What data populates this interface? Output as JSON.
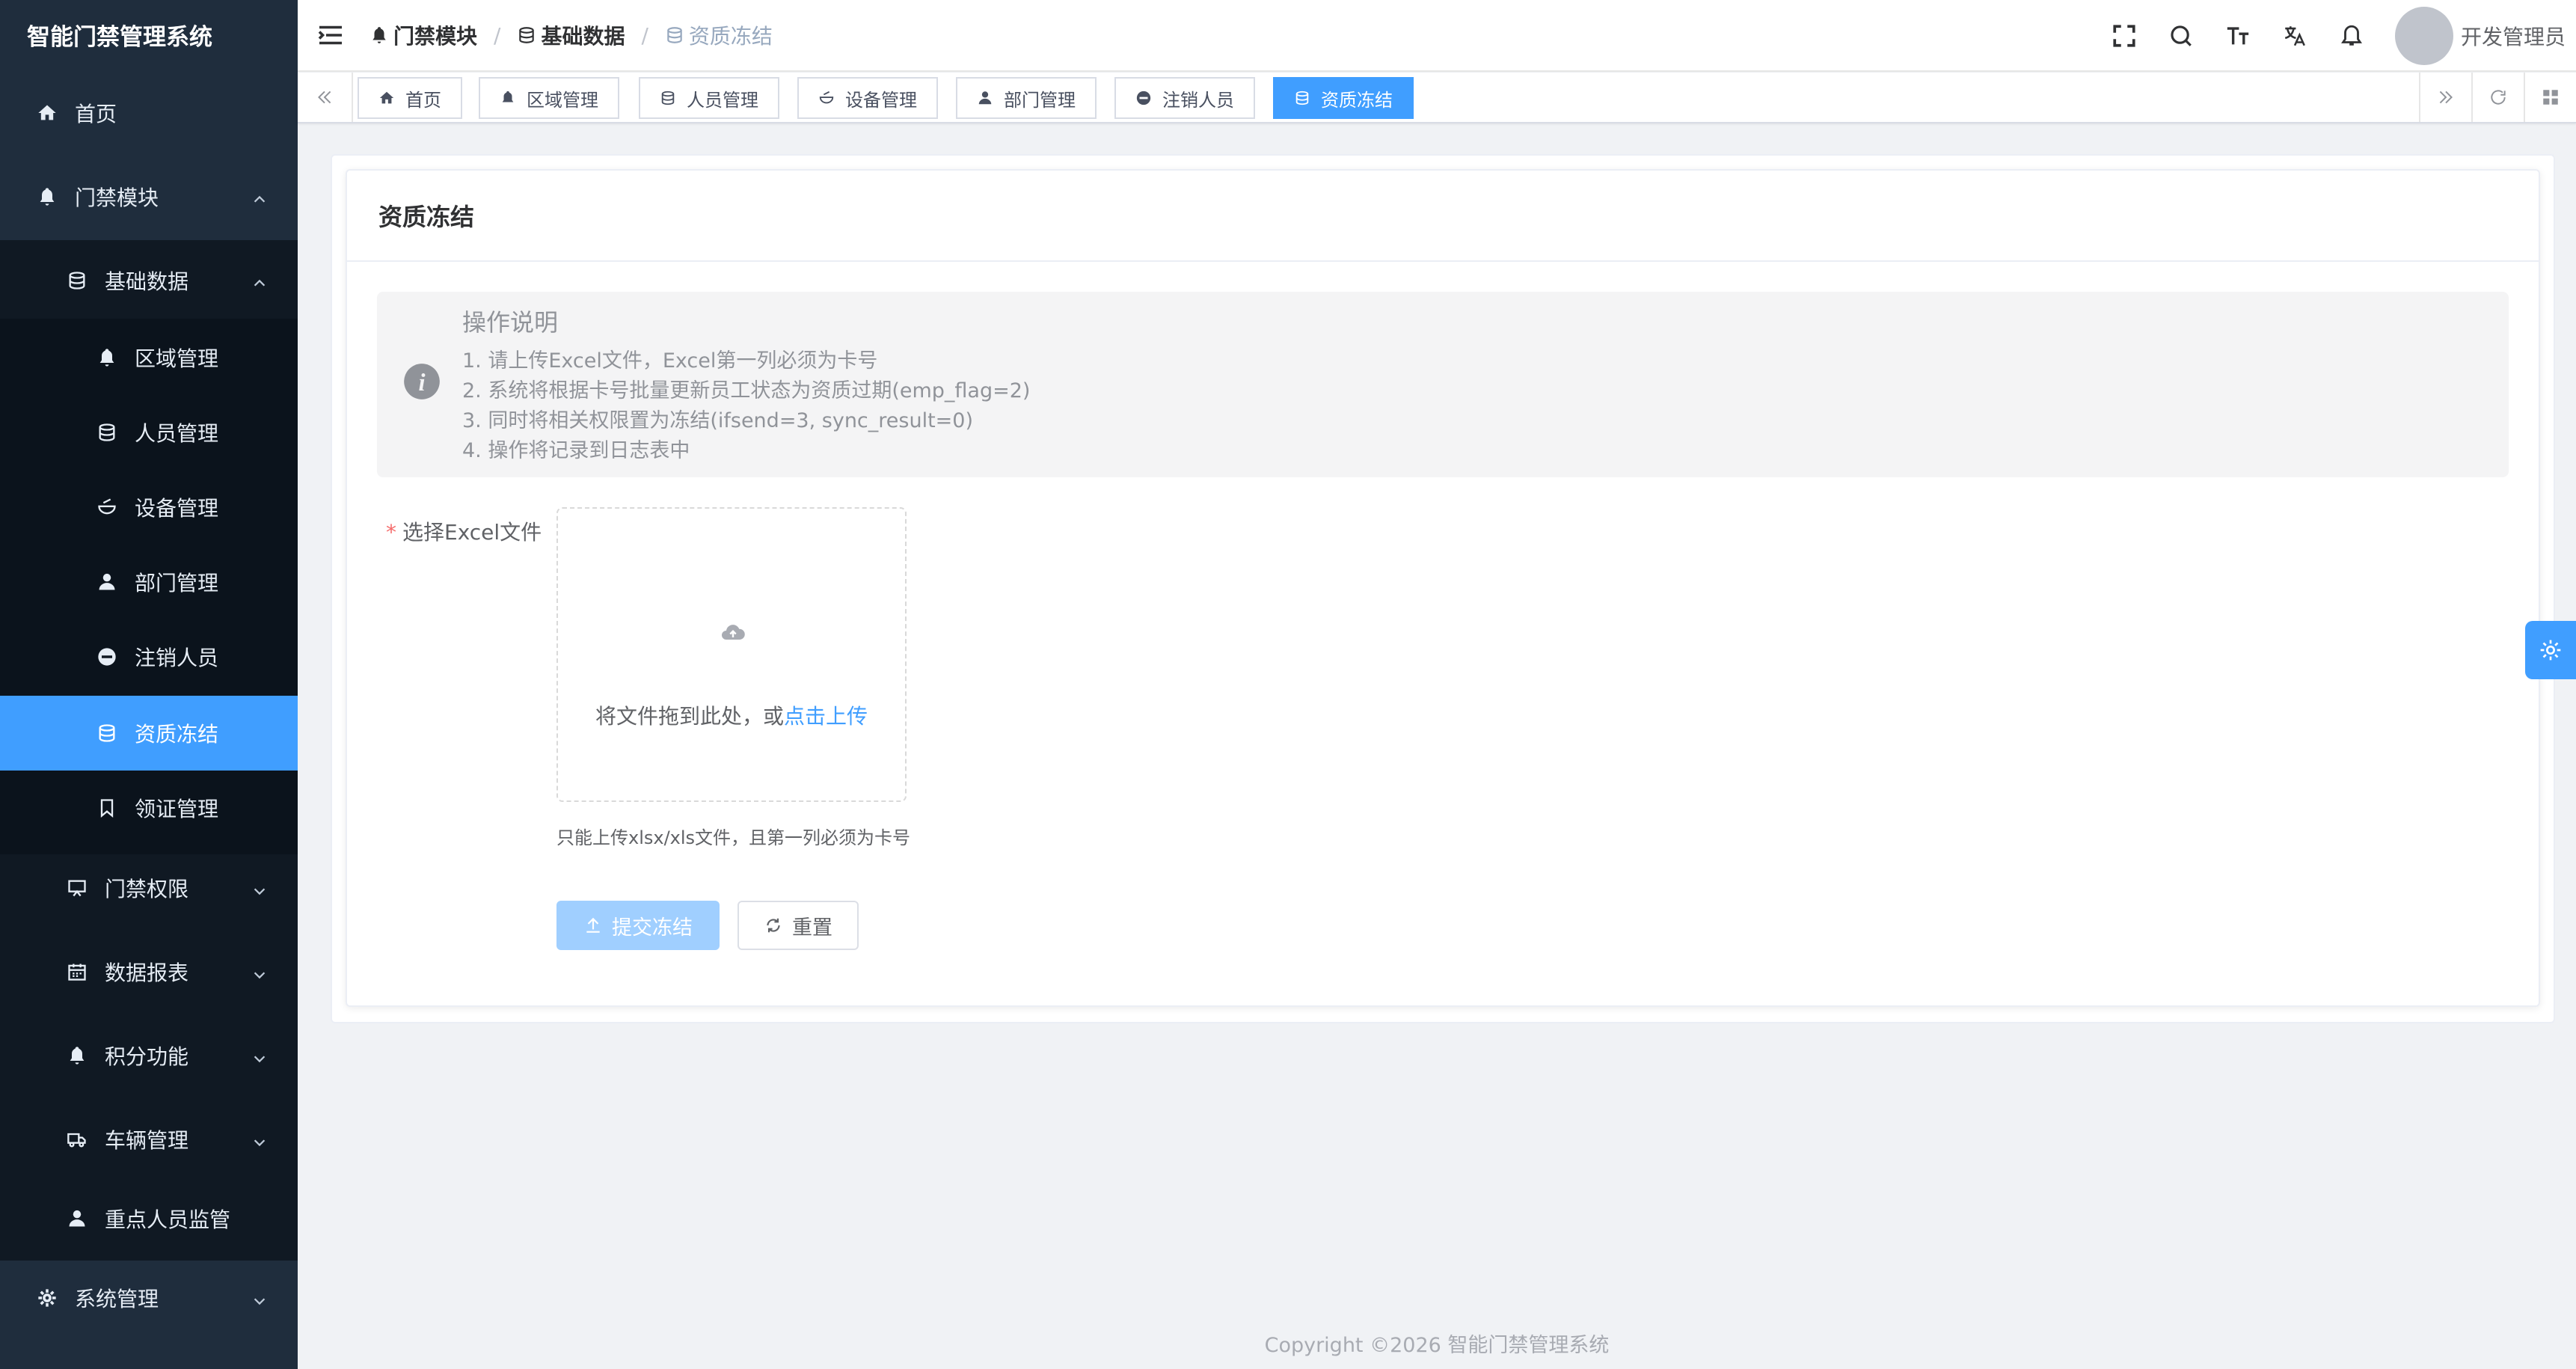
{
  "app": {
    "title": "智能门禁管理系统"
  },
  "sidebar": {
    "home": "首页",
    "access_module": "门禁模块",
    "basic_data": "基础数据",
    "items": {
      "area": "区域管理",
      "people": "人员管理",
      "device": "设备管理",
      "dept": "部门管理",
      "cancel": "注销人员",
      "freeze": "资质冻结",
      "cert": "领证管理"
    },
    "access_rights": "门禁权限",
    "reports": "数据报表",
    "points": "积分功能",
    "vehicles": "车辆管理",
    "key_people": "重点人员监管",
    "system": "系统管理"
  },
  "header": {
    "breadcrumb": [
      "门禁模块",
      "基础数据",
      "资质冻结"
    ],
    "separator": "/",
    "username": "开发管理员"
  },
  "tags": [
    "首页",
    "区域管理",
    "人员管理",
    "设备管理",
    "部门管理",
    "注销人员",
    "资质冻结"
  ],
  "page": {
    "title": "资质冻结",
    "alert": {
      "title": "操作说明",
      "lines": [
        "1. 请上传Excel文件，Excel第一列必须为卡号",
        "2. 系统将根据卡号批量更新员工状态为资质过期(emp_flag=2)",
        "3. 同时将相关权限置为冻结(ifsend=3, sync_result=0)",
        "4. 操作将记录到日志表中"
      ]
    },
    "form": {
      "required_mark": "*",
      "label": "选择Excel文件",
      "upload_text": "将文件拖到此处，或",
      "upload_link": "点击上传",
      "tip": "只能上传xlsx/xls文件，且第一列必须为卡号",
      "submit": "提交冻结",
      "reset": "重置"
    }
  },
  "footer": {
    "copyright": "Copyright ©2026 智能门禁管理系统"
  },
  "colors": {
    "primary": "#409eff",
    "sidebar_bg": "#1f2d3d",
    "submit_disabled": "#a0cfff"
  }
}
